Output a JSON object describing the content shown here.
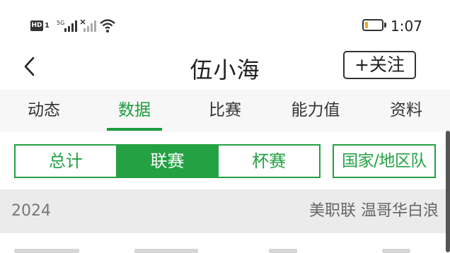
{
  "status_bar": {
    "hd_label": "HD",
    "hd_sub": "1",
    "network_label": "5G",
    "time": "1:07",
    "battery_level": 0.2,
    "battery_color": "#f5a623",
    "icons": [
      "hd-icon",
      "signal-icon",
      "wifi-icon",
      "battery-icon"
    ]
  },
  "header": {
    "back_icon": "chevron-left-icon",
    "title": "伍小海",
    "follow_label": "+关注"
  },
  "tabs": {
    "items": [
      {
        "label": "动态",
        "active": false
      },
      {
        "label": "数据",
        "active": true
      },
      {
        "label": "比赛",
        "active": false
      },
      {
        "label": "能力值",
        "active": false
      },
      {
        "label": "资料",
        "active": false
      }
    ],
    "accent_color": "#1a9d3e"
  },
  "segment": {
    "items": [
      {
        "label": "总计",
        "active": false
      },
      {
        "label": "联赛",
        "active": true
      },
      {
        "label": "杯赛",
        "active": false
      }
    ],
    "team_label": "国家/地区队",
    "accent_color": "#23a143"
  },
  "season": {
    "year": "2024",
    "team": "美职联 温哥华白浪"
  }
}
